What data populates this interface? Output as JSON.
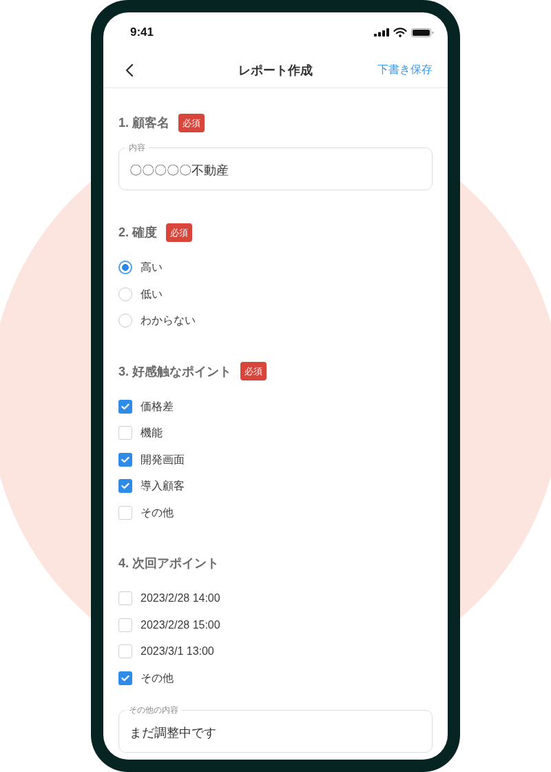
{
  "status_bar": {
    "time": "9:41"
  },
  "nav_bar": {
    "title": "レポート作成",
    "action": "下書き保存"
  },
  "sections": [
    {
      "heading": "1. 顧客名",
      "badge": "必須",
      "kind": "text",
      "field": {
        "label": "内容",
        "value": "〇〇〇〇〇不動産"
      }
    },
    {
      "heading": "2. 確度",
      "badge": "必須",
      "kind": "radio",
      "options": [
        {
          "label": "高い",
          "selected": true
        },
        {
          "label": "低い",
          "selected": false
        },
        {
          "label": "わからない",
          "selected": false
        }
      ]
    },
    {
      "heading": "3. 好感触なポイント",
      "badge": "必須",
      "kind": "checkbox",
      "options": [
        {
          "label": "価格差",
          "checked": true
        },
        {
          "label": "機能",
          "checked": false
        },
        {
          "label": "開発画面",
          "checked": true
        },
        {
          "label": "導入顧客",
          "checked": true
        },
        {
          "label": "その他",
          "checked": false
        }
      ]
    },
    {
      "heading": "4. 次回アポイント",
      "kind": "checkbox",
      "options": [
        {
          "label": "2023/2/28 14:00",
          "checked": false
        },
        {
          "label": "2023/2/28 15:00",
          "checked": false
        },
        {
          "label": "2023/3/1 13:00",
          "checked": false
        },
        {
          "label": "その他",
          "checked": true
        }
      ],
      "field": {
        "label": "その他の内容",
        "value": "まだ調整中です"
      }
    }
  ]
}
